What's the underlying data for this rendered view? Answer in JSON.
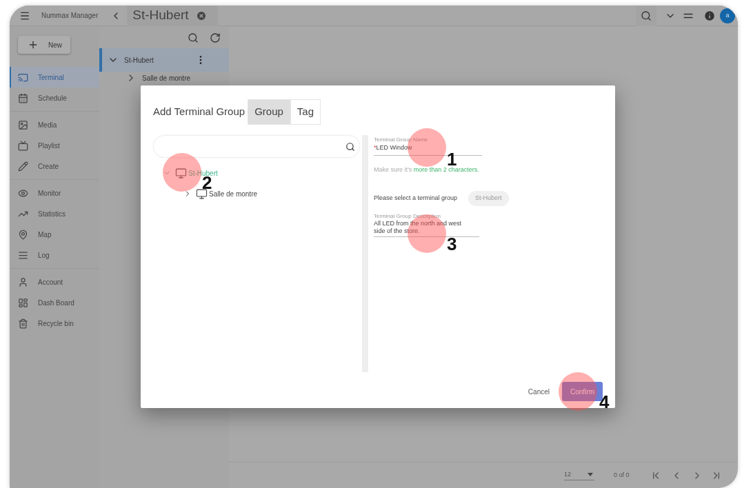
{
  "app_bar": {
    "app_name": "Nummax Manager",
    "tab_title": "St-Hubert",
    "avatar_letter": "a"
  },
  "sidebar": {
    "new_button": "New",
    "groups": [
      [
        {
          "label": "Terminal",
          "selected": true
        },
        {
          "label": "Schedule",
          "selected": false
        }
      ],
      [
        {
          "label": "Media",
          "selected": false
        },
        {
          "label": "Playlist",
          "selected": false
        },
        {
          "label": "Create",
          "selected": false
        }
      ],
      [
        {
          "label": "Monitor",
          "selected": false
        },
        {
          "label": "Statistics",
          "selected": false
        },
        {
          "label": "Map",
          "selected": false
        },
        {
          "label": "Log",
          "selected": false
        }
      ],
      [
        {
          "label": "Account",
          "selected": false
        },
        {
          "label": "Dash Board",
          "selected": false
        },
        {
          "label": "Recycle bin",
          "selected": false
        }
      ]
    ]
  },
  "tree_panel": {
    "items": [
      {
        "label": "St-Hubert",
        "selected": true,
        "expanded": true,
        "children": [
          {
            "label": "Salle de montre",
            "selected": false,
            "expanded": false
          }
        ]
      }
    ]
  },
  "dialog": {
    "title": "Add Terminal Group",
    "mode_tabs": [
      {
        "label": "Group",
        "selected": true
      },
      {
        "label": "Tag",
        "selected": false
      }
    ],
    "tree": [
      {
        "label": "St-Hubert",
        "selected": true,
        "expanded": true,
        "children": [
          {
            "label": "Salle de montre",
            "selected": false,
            "expanded": false
          }
        ]
      }
    ],
    "name_field": {
      "label": "Terminal Group Name",
      "required_mark": "*",
      "value": "LED Window"
    },
    "hint": {
      "text": "Make sure it's ",
      "highlight": "more than 2 characters."
    },
    "group_select": {
      "label": "Please select a terminal group",
      "chip": "St-Hubert"
    },
    "description_field": {
      "label": "Terminal Group Description",
      "value": "All LED from the north and west side of the store."
    },
    "cancel_button": "Cancel",
    "confirm_button": "Confirm"
  },
  "pagination": {
    "page_size": "12",
    "range": "0 of 0"
  },
  "callouts": [
    {
      "number": "1"
    },
    {
      "number": "2"
    },
    {
      "number": "3"
    },
    {
      "number": "4"
    }
  ]
}
